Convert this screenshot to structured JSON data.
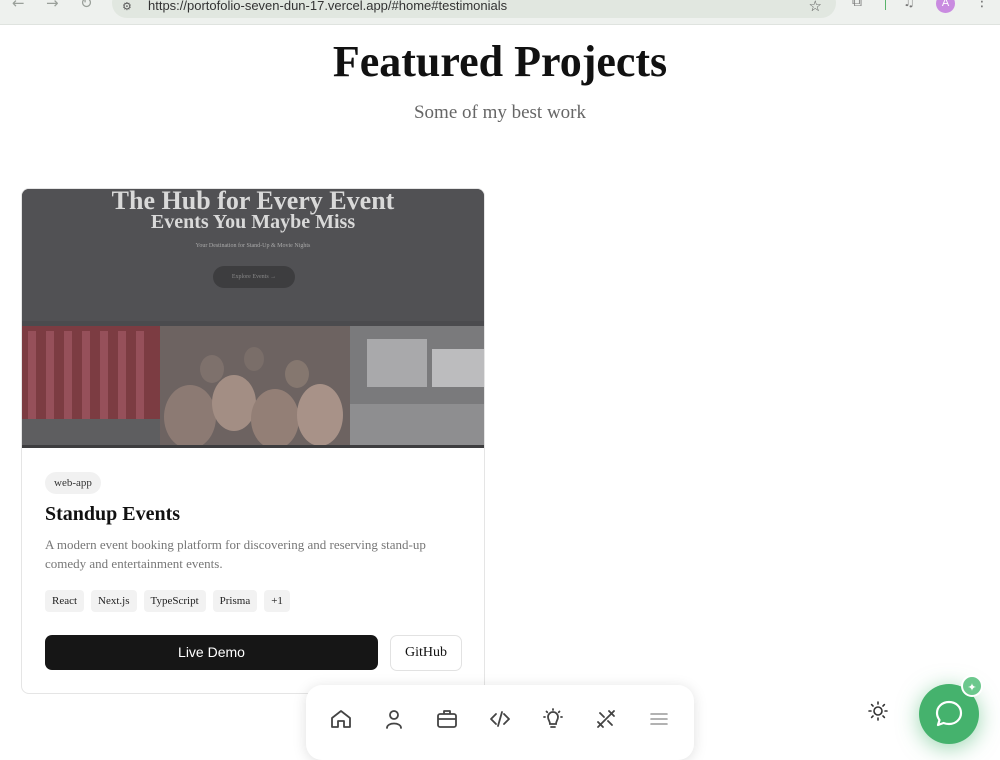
{
  "browser": {
    "url": "https://portofolio-seven-dun-17.vercel.app/#home#testimonials",
    "profile_initial": "A",
    "icons": [
      "back-icon",
      "forward-icon",
      "reload-icon",
      "site-info-icon",
      "bookmark-star-icon",
      "extensions-icon",
      "media-icon",
      "menu-dots-icon"
    ]
  },
  "section": {
    "title": "Featured Projects",
    "subtitle": "Some of my best work"
  },
  "project": {
    "thumbnail": {
      "heading_line1": "The Hub for Every Event",
      "heading_line2": "Events You Maybe Miss",
      "tagline": "Your Destination for Stand-Up & Movie Nights",
      "button_label": "Explore Events →"
    },
    "category": "web-app",
    "title": "Standup Events",
    "description": "A modern event booking platform for discovering and reserving stand-up comedy and entertainment events.",
    "tags": [
      "React",
      "Next.js",
      "TypeScript",
      "Prisma",
      "+1"
    ],
    "live_demo_label": "Live Demo",
    "github_label": "GitHub"
  },
  "dock": {
    "items": [
      "home-icon",
      "user-icon",
      "briefcase-icon",
      "code-icon",
      "lightbulb-icon",
      "tools-icon",
      "menu-icon"
    ]
  },
  "floating": {
    "theme_icon": "sun-icon",
    "chat_icon": "chat-bubble-icon",
    "badge_icon": "sparkle-icon"
  },
  "colors": {
    "accent_green": "#45b26d",
    "button_dark": "#161616",
    "text_muted": "#777777"
  }
}
